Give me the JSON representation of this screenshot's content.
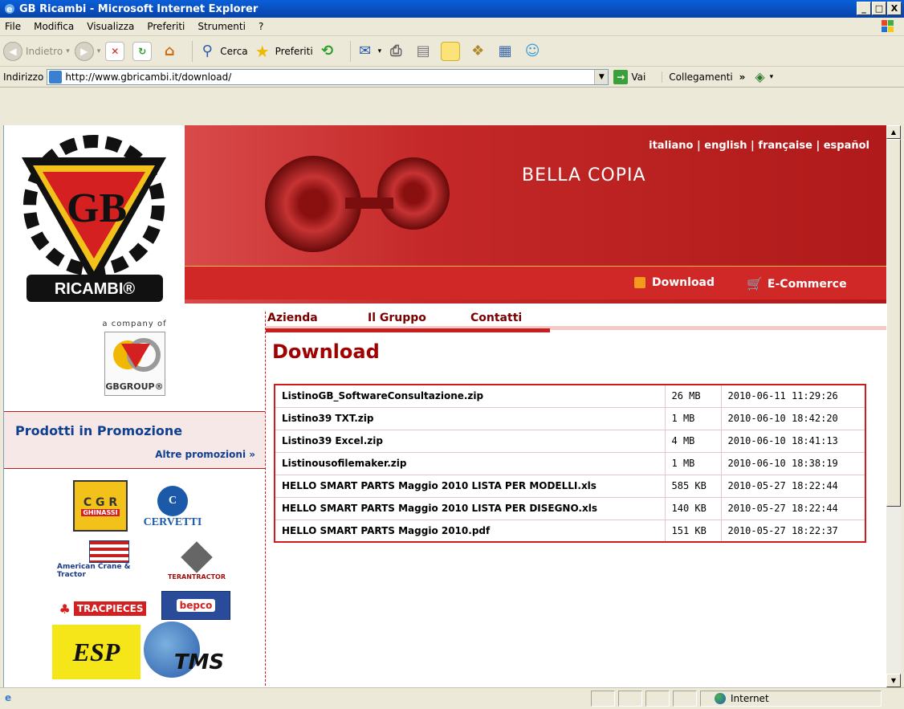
{
  "window": {
    "title": "GB Ricambi - Microsoft Internet Explorer",
    "minimize": "_",
    "maximize": "□",
    "close": "X"
  },
  "menu": [
    "File",
    "Modifica",
    "Visualizza",
    "Preferiti",
    "Strumenti",
    "?"
  ],
  "toolbar": {
    "back": "Indietro",
    "search": "Cerca",
    "favorites": "Preferiti"
  },
  "address": {
    "label": "Indirizzo",
    "url": "http://www.gbricambi.it/download/",
    "go": "Vai",
    "links": "Collegamenti"
  },
  "site": {
    "languages": "italiano | english | française | español",
    "hero_caption": "BELLA COPIA",
    "download_link": "Download",
    "ecommerce_link": "E-Commerce",
    "logo_text": "RICAMBI®",
    "company_of": "a company of",
    "gbgroup": "GBGROUP®",
    "nav": [
      "Azienda",
      "Il Gruppo",
      "Contatti"
    ],
    "page_title": "Download",
    "promo_title": "Prodotti in Promozione",
    "promo_more": "Altre promozioni »",
    "brands": {
      "cgr": "C G R",
      "cgr_sub": "GHINASSI",
      "cervetti": "CERVETTI",
      "american": "American Crane & Tractor",
      "teran": "TERANTRACTOR",
      "tracpieces": "TRACPIECES",
      "bepco": "bepco",
      "esp": "ESP",
      "tms": "TMS"
    }
  },
  "downloads": [
    {
      "name": "ListinoGB_SoftwareConsultazione.zip",
      "size": "26 MB",
      "date": "2010-06-11 11:29:26"
    },
    {
      "name": "Listino39 TXT.zip",
      "size": "1 MB",
      "date": "2010-06-10 18:42:20"
    },
    {
      "name": "Listino39 Excel.zip",
      "size": "4 MB",
      "date": "2010-06-10 18:41:13"
    },
    {
      "name": "Listinousofilemaker.zip",
      "size": "1 MB",
      "date": "2010-06-10 18:38:19"
    },
    {
      "name": "HELLO SMART PARTS Maggio 2010 LISTA PER MODELLI.xls",
      "size": "585 KB",
      "date": "2010-05-27 18:22:44"
    },
    {
      "name": "HELLO SMART PARTS Maggio 2010 LISTA PER DISEGNO.xls",
      "size": "140 KB",
      "date": "2010-05-27 18:22:44"
    },
    {
      "name": "HELLO SMART PARTS Maggio 2010.pdf",
      "size": "151 KB",
      "date": "2010-05-27 18:22:37"
    }
  ],
  "status": {
    "zone": "Internet"
  },
  "colors": {
    "brand_red": "#c81e1e",
    "title_red": "#a00000",
    "promo_blue": "#0f3f8f"
  }
}
